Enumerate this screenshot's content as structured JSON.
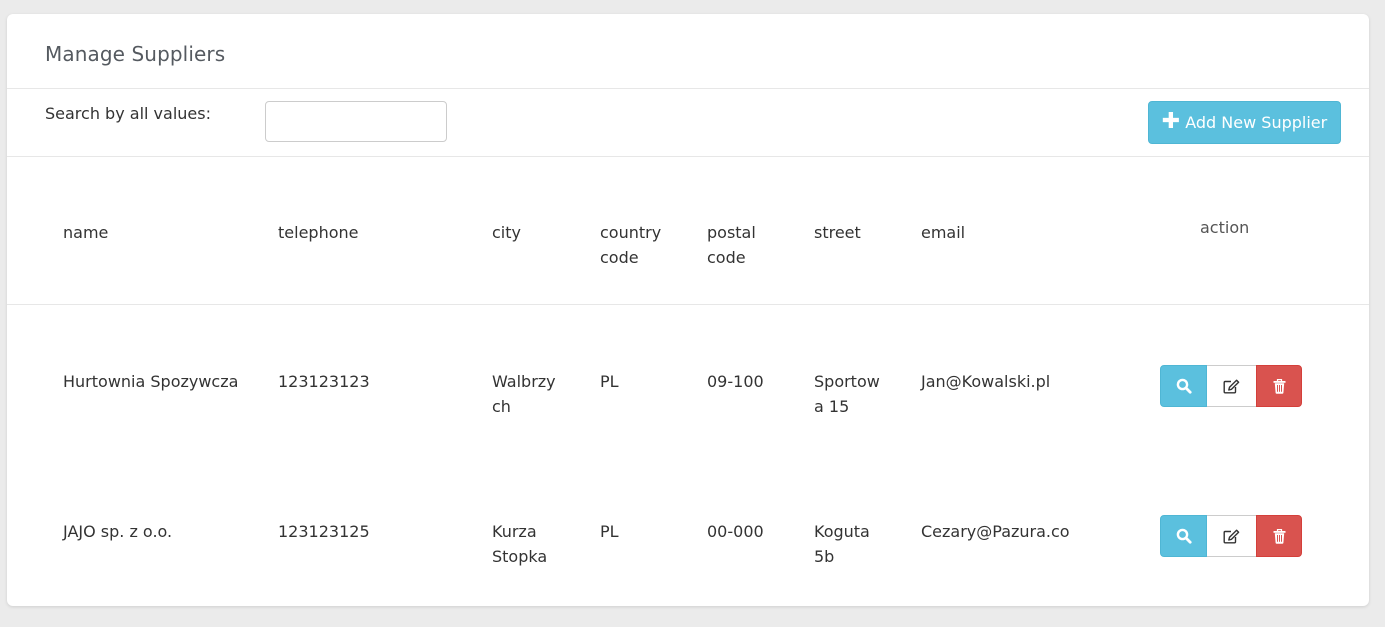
{
  "page": {
    "title": "Manage Suppliers"
  },
  "search": {
    "label": "Search by all values:",
    "value": "",
    "placeholder": ""
  },
  "toolbar": {
    "add_label": "Add New Supplier",
    "add_icon": "plus-icon"
  },
  "table": {
    "headers": {
      "name": "name",
      "telephone": "telephone",
      "city": "city",
      "country_code": [
        "country",
        "code"
      ],
      "postal_code": [
        "postal",
        "code"
      ],
      "street": "street",
      "email": "email",
      "action": "action"
    },
    "rows": [
      {
        "name": "Hurtownia Spozywcza",
        "telephone": "123123123",
        "city": [
          "Walbrzy",
          "ch"
        ],
        "country_code": "PL",
        "postal_code": "09-100",
        "street": [
          "Sportow",
          "a 15"
        ],
        "email": "Jan@Kowalski.pl"
      },
      {
        "name": "JAJO sp. z o.o.",
        "telephone": "123123125",
        "city": [
          "Kurza",
          "Stopka"
        ],
        "country_code": "PL",
        "postal_code": "00-000",
        "street": [
          "Koguta",
          "5b"
        ],
        "email": "Cezary@Pazura.co"
      }
    ],
    "row_actions": [
      "search-icon",
      "edit-icon",
      "trash-icon"
    ]
  },
  "colors": {
    "info": "#5bc0de",
    "danger": "#d9534f",
    "background": "#ebebeb"
  }
}
